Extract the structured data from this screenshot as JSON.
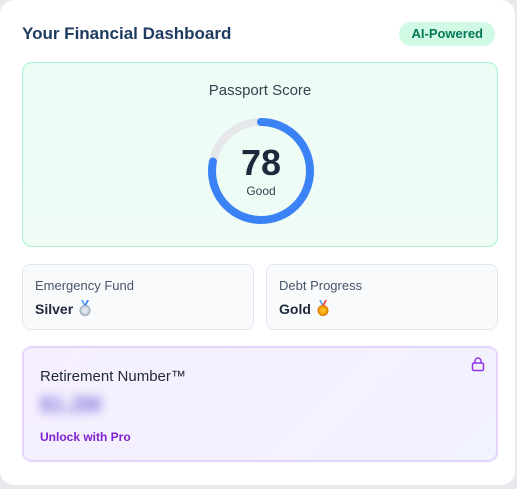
{
  "header": {
    "title": "Your Financial Dashboard",
    "badge": "AI-Powered"
  },
  "passport": {
    "label": "Passport Score",
    "score": "78",
    "rating": "Good",
    "progress": 0.78,
    "ring_color": "#3b82f6",
    "track_color": "#e5e7eb"
  },
  "emergency_fund": {
    "label": "Emergency Fund",
    "value": "Silver",
    "medal_icon": "silver-medal-icon"
  },
  "debt_progress": {
    "label": "Debt Progress",
    "value": "Gold",
    "medal_icon": "gold-medal-icon"
  },
  "retirement": {
    "label": "Retirement Number™",
    "value": "$1.2M",
    "cta": "Unlock with Pro",
    "lock_icon": "lock-icon"
  },
  "colors": {
    "accent_green": "#047857",
    "accent_blue": "#3b82f6",
    "accent_purple": "#7e22ce"
  }
}
